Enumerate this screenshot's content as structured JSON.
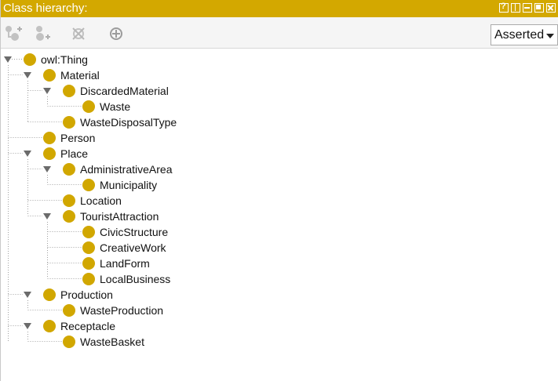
{
  "title": "Class hierarchy:",
  "window_buttons": [
    "help",
    "split",
    "minimize",
    "maximize",
    "close"
  ],
  "toolbar": {
    "icons": [
      "add-subclass-icon",
      "add-sibling-icon",
      "delete-class-icon",
      "target-icon"
    ],
    "select_value": "Asserted"
  },
  "accent_color": "#d3a800",
  "tree": {
    "root": "owl:Thing",
    "material": "Material",
    "discarded_material": "DiscardedMaterial",
    "waste": "Waste",
    "waste_disposal_type": "WasteDisposalType",
    "person": "Person",
    "place": "Place",
    "administrative_area": "AdministrativeArea",
    "municipality": "Municipality",
    "location": "Location",
    "tourist_attraction": "TouristAttraction",
    "civic_structure": "CivicStructure",
    "creative_work": "CreativeWork",
    "land_form": "LandForm",
    "local_business": "LocalBusiness",
    "production": "Production",
    "waste_production": "WasteProduction",
    "receptacle": "Receptacle",
    "waste_basket": "WasteBasket"
  }
}
